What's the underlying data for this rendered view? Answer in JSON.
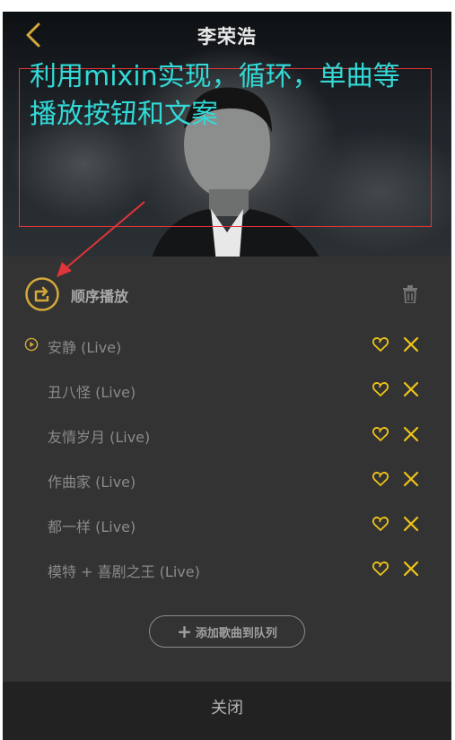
{
  "header": {
    "title": "李荣浩"
  },
  "annotation": {
    "text": "利用mixin实现，循环，单曲等播放按钮和文案"
  },
  "playlist": {
    "mode_label": "顺序播放",
    "songs": [
      {
        "title": "安静 (Live)",
        "playing": true
      },
      {
        "title": "丑八怪 (Live)",
        "playing": false
      },
      {
        "title": "友情岁月 (Live)",
        "playing": false
      },
      {
        "title": "作曲家 (Live)",
        "playing": false
      },
      {
        "title": "都一样 (Live)",
        "playing": false
      },
      {
        "title": "模特 + 喜剧之王 (Live)",
        "playing": false
      }
    ],
    "add_label": "添加歌曲到队列"
  },
  "footer": {
    "close_label": "关闭"
  },
  "colors": {
    "accent": "#d4a93a",
    "icon_yellow": "#f0c419",
    "annotation_red": "#e0343a",
    "annotation_text": "#32d9d6",
    "panel_bg": "#333333"
  },
  "icons": [
    "back-chevron-icon",
    "sequence-play-icon",
    "trash-icon",
    "now-playing-icon",
    "heart-icon",
    "close-icon",
    "plus-icon"
  ]
}
